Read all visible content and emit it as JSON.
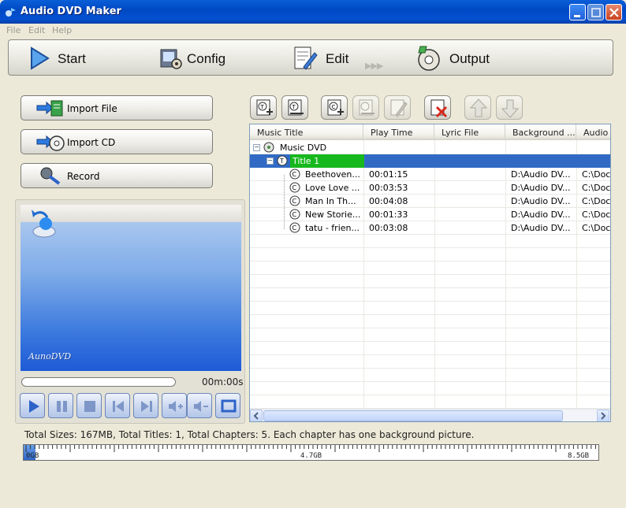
{
  "window": {
    "title": "Audio DVD Maker"
  },
  "menu": [
    "File",
    "Edit",
    "Help"
  ],
  "steps": [
    {
      "label": "Start",
      "icon": "play-arrow-icon"
    },
    {
      "label": "Config",
      "icon": "config-gear-icon"
    },
    {
      "label": "Edit",
      "icon": "edit-pencil-icon"
    },
    {
      "label": "Output",
      "icon": "output-disc-icon"
    }
  ],
  "steps_arrows": "▶▶▶",
  "left_buttons": [
    {
      "label": "Import File",
      "icon": "import-file-icon"
    },
    {
      "label": "Import CD",
      "icon": "import-cd-icon"
    },
    {
      "label": "Record",
      "icon": "microphone-icon"
    }
  ],
  "preview": {
    "brand": "AunoDVD",
    "time": "00m:00s",
    "controls": [
      "play-icon",
      "pause-icon",
      "stop-icon",
      "previous-icon",
      "next-icon",
      "volume-up-icon",
      "volume-down-icon",
      "fullscreen-icon"
    ]
  },
  "toolbar": [
    {
      "name": "add-title-icon",
      "enabled": true
    },
    {
      "name": "edit-title-icon",
      "enabled": true
    },
    {
      "name": "add-chapter-icon",
      "enabled": true
    },
    {
      "name": "copy-chapter-icon",
      "enabled": false
    },
    {
      "name": "edit-chapter-icon",
      "enabled": false
    },
    {
      "name": "delete-icon",
      "enabled": true
    },
    {
      "name": "move-up-icon",
      "enabled": false
    },
    {
      "name": "move-down-icon",
      "enabled": false
    }
  ],
  "list": {
    "columns": [
      "Music Title",
      "Play Time",
      "Lyric File",
      "Background ...",
      "Audio F"
    ],
    "root": "Music DVD",
    "title": "Title 1",
    "chapters": [
      {
        "name": "Beethoven...",
        "time": "00:01:15",
        "lyric": "",
        "background": "D:\\Audio DV...",
        "audio": "C:\\Docu"
      },
      {
        "name": "Love Love ...",
        "time": "00:03:53",
        "lyric": "",
        "background": "D:\\Audio DV...",
        "audio": "C:\\Docu"
      },
      {
        "name": "Man In Th...",
        "time": "00:04:08",
        "lyric": "",
        "background": "D:\\Audio DV...",
        "audio": "C:\\Docu"
      },
      {
        "name": "New Storie...",
        "time": "00:01:33",
        "lyric": "",
        "background": "D:\\Audio DV...",
        "audio": "C:\\Docu"
      },
      {
        "name": "tatu - frien...",
        "time": "00:03:08",
        "lyric": "",
        "background": "D:\\Audio DV...",
        "audio": "C:\\Docu"
      }
    ]
  },
  "status": {
    "text": "Total Sizes: 167MB, Total Titles: 1, Total Chapters: 5. Each chapter has one background picture.",
    "ruler_labels": [
      "0GB",
      "4.7GB",
      "8.5GB"
    ],
    "used_fraction": 0.02
  },
  "colors": {
    "titlebar": "#0054e3",
    "selection": "#316ac5",
    "title_highlight": "#16b81d"
  }
}
